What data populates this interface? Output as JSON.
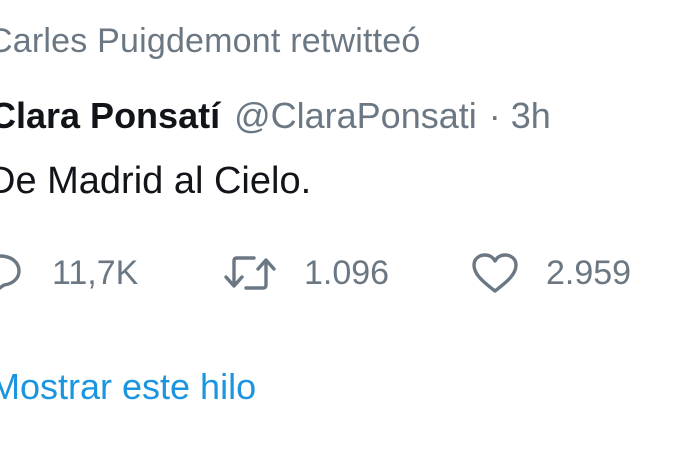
{
  "retweet_context": "Carles Puigdemont retwitteó",
  "tweet": {
    "author_name": "Clara Ponsatí",
    "author_handle": "@ClaraPonsati",
    "separator": "·",
    "timestamp": "3h",
    "text": "De Madrid al Cielo."
  },
  "actions": {
    "reply": {
      "icon": "reply-icon",
      "count": "11,7K"
    },
    "retweet": {
      "icon": "retweet-icon",
      "count": "1.096"
    },
    "like": {
      "icon": "heart-icon",
      "count": "2.959"
    }
  },
  "show_thread_label": "Mostrar este hilo",
  "colors": {
    "text_primary": "#111418",
    "text_secondary": "#6b7883",
    "link": "#1b95e0",
    "background": "#ffffff"
  }
}
